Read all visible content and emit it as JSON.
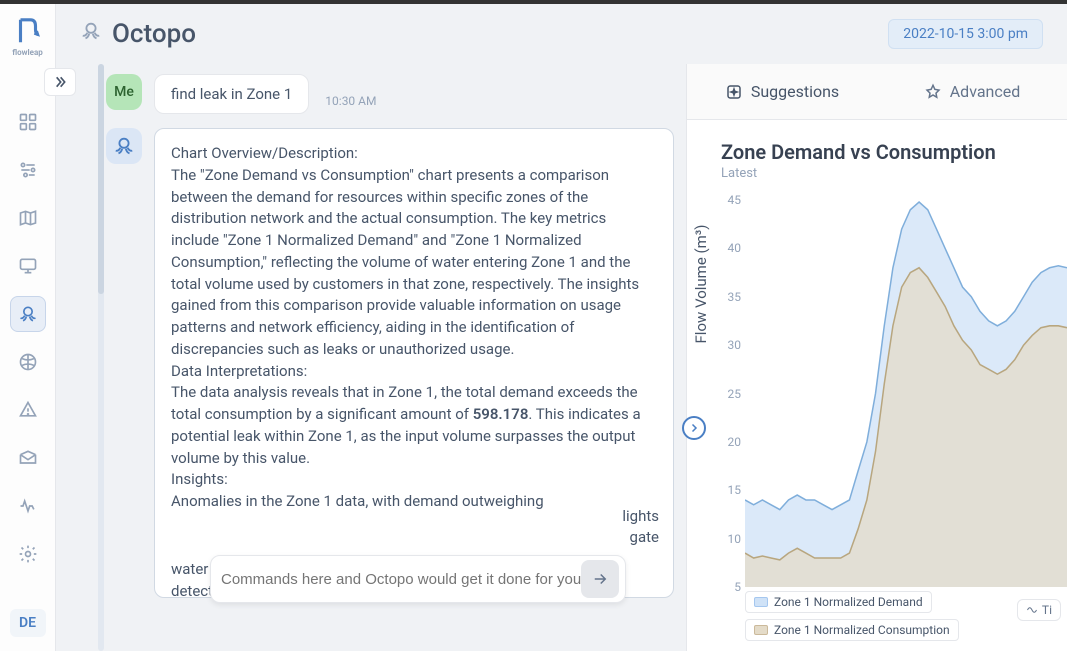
{
  "app": {
    "logo_text": "flowleap",
    "lang": "DE"
  },
  "header": {
    "title": "Octopo",
    "timestamp": "2022-10-15 3:00 pm"
  },
  "chat": {
    "me_label": "Me",
    "user_message": "find leak in Zone 1",
    "user_time": "10:30 AM",
    "bot_text_1": "Chart Overview/Description:",
    "bot_text_2": "The \"Zone Demand vs Consumption\" chart presents a comparison between the demand for resources within specific zones of the distribution network and the actual consumption. The key metrics include \"Zone 1 Normalized Demand\" and \"Zone 1 Normalized Consumption,\" reflecting the volume of water entering Zone 1 and the total volume used by customers in that zone, respectively. The insights gained from this comparison provide valuable information on usage patterns and network efficiency, aiding in the identification of discrepancies such as leaks or unauthorized usage.",
    "bot_text_3": "Data Interpretations:",
    "bot_text_4a": "The data analysis reveals that in Zone 1, the total demand exceeds the total consumption by a significant amount of ",
    "bot_text_4_bold": "598.178",
    "bot_text_4b": ". This indicates a potential leak within Zone 1, as the input volume surpasses the output volume by this value.",
    "bot_text_5": "Insights:",
    "bot_text_6": "Anomalies in the Zone 1 data, with demand outweighing",
    "bot_overlay_1": "lights",
    "bot_overlay_2": "gate",
    "bot_text_7": "water loss and ensure network efficiency. No alerts or errors were detected in the metrics for this analysis.",
    "input_placeholder": "Commands here and Octopo would get it done for you"
  },
  "tabs": {
    "suggestions": "Suggestions",
    "advanced": "Advanced"
  },
  "chart_data": {
    "type": "area",
    "title": "Zone Demand vs Consumption",
    "subtitle": "Latest",
    "ylabel": "Flow Volume (m³)",
    "ylim": [
      5,
      45
    ],
    "y_ticks": [
      5,
      10,
      15,
      20,
      25,
      30,
      35,
      40,
      45
    ],
    "series": [
      {
        "name": "Zone 1 Normalized Demand",
        "color": "#a5c7ef",
        "values": [
          14,
          13.5,
          14,
          13.5,
          13,
          14,
          14.5,
          14,
          14,
          13.5,
          13,
          13.5,
          14,
          17,
          20,
          25,
          32,
          38,
          42,
          44,
          44.8,
          44,
          42,
          40,
          38,
          36,
          35,
          33.5,
          32.5,
          32,
          32.5,
          33.5,
          35,
          36.5,
          37.5,
          38,
          38.2,
          38
        ]
      },
      {
        "name": "Zone 1 Normalized Consumption",
        "color": "#cbb99a",
        "values": [
          8.5,
          8,
          8.2,
          8,
          7.8,
          8.5,
          9,
          8.5,
          8,
          8,
          8,
          8,
          8.5,
          11,
          14,
          19,
          26,
          32,
          36,
          37.5,
          38,
          37,
          35.5,
          34,
          32,
          30.5,
          29.5,
          28,
          27.5,
          27,
          27.5,
          28.5,
          30,
          31,
          31.8,
          32,
          32,
          31.8
        ]
      }
    ],
    "tool_label": "Ti"
  }
}
